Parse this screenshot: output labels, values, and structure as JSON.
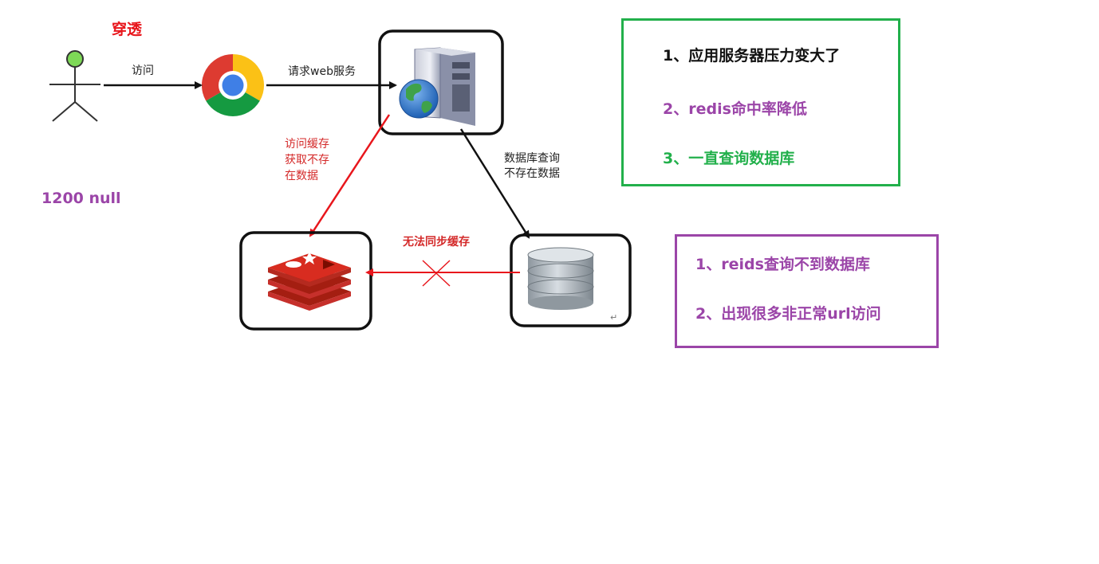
{
  "title": "穿透",
  "null_label": "1200 null",
  "edges": {
    "visit": "访问",
    "request_web": "请求web服务",
    "cache_miss": "访问缓存\n获取不存\n在数据",
    "db_query": "数据库查询\n不存在数据",
    "cannot_sync": "无法同步缓存"
  },
  "nodes": {
    "user": "user-stick-figure-icon",
    "browser": "chrome-browser-icon",
    "server": "web-server-icon",
    "cache": "redis-icon",
    "database": "database-icon"
  },
  "consequences": [
    {
      "text": "1、应用服务器压力变大了",
      "color": "#111111"
    },
    {
      "text": "2、redis命中率降低",
      "color": "#9b45a8"
    },
    {
      "text": "3、一直查询数据库",
      "color": "#22b04b"
    }
  ],
  "causes": [
    {
      "text": "1、reids查询不到数据库",
      "color": "#9b45a8"
    },
    {
      "text": "2、出现很多非正常url访问",
      "color": "#9b45a8"
    }
  ],
  "colors": {
    "red": "#e8161c",
    "green": "#22b04b",
    "purple": "#9b45a8",
    "redis_red": "#d82c20"
  },
  "return_mark": "↵"
}
